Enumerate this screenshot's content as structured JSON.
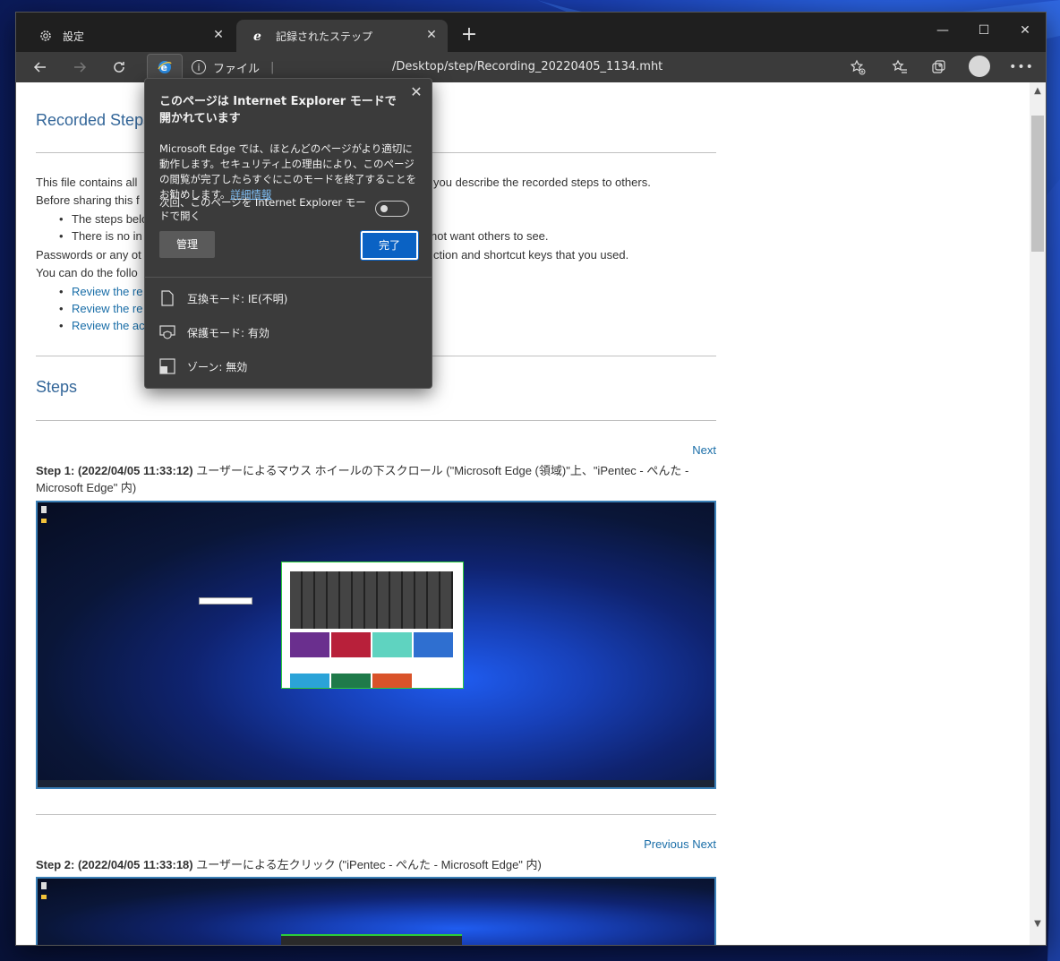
{
  "tabs": [
    {
      "label": "設定",
      "icon": "gear-icon"
    },
    {
      "label": "記録されたステップ",
      "icon": "edge-ie-icon"
    }
  ],
  "toolbar": {
    "site_label": "ファイル",
    "url": "/Desktop/step/Recording_20220405_1134.mht"
  },
  "popup": {
    "title": "このページは Internet Explorer モードで開かれています",
    "description": "Microsoft Edge では、ほとんどのページがより適切に動作します。セキュリティ上の理由により、このページの閲覧が完了したらすぐにこのモードを終了することをお勧めします。",
    "more_info": "詳細情報",
    "toggle_label": "次回、このページを Internet Explorer モードで開く",
    "toggle_on": false,
    "manage_label": "管理",
    "done_label": "完了",
    "info": [
      {
        "label": "互換モード: IE(不明)",
        "icon": "document-icon"
      },
      {
        "label": "保護モード: 有効",
        "icon": "shield-icon"
      },
      {
        "label": "ゾーン: 無効",
        "icon": "zone-icon"
      }
    ]
  },
  "doc": {
    "heading": "Recorded Steps",
    "intro1": "This file contains all",
    "intro1_tail": "you describe the recorded steps to others.",
    "intro2": "Before sharing this f",
    "bullet1": "The steps belo",
    "bullet2": "There is no in",
    "bullet2_tail": "not want others to see.",
    "intro3": "Passwords or any ot",
    "intro3_tail": "ction and shortcut keys that you used.",
    "intro4": "You can do the follo",
    "links": [
      "Review the re",
      "Review the re",
      "Review the ac"
    ],
    "steps_heading": "Steps",
    "next_label": "Next",
    "previous_label": "Previous",
    "step1_label": "Step 1: (2022/04/05 11:33:12)",
    "step1_text": "ユーザーによるマウス ホイールの下スクロール (\"Microsoft Edge (領域)\"上、\"iPentec - ぺんた - Microsoft Edge\" 内)",
    "step2_label": "Step 2: (2022/04/05 11:33:18)",
    "step2_text": "ユーザーによる左クリック (\"iPentec - ぺんた - Microsoft Edge\" 内)"
  }
}
